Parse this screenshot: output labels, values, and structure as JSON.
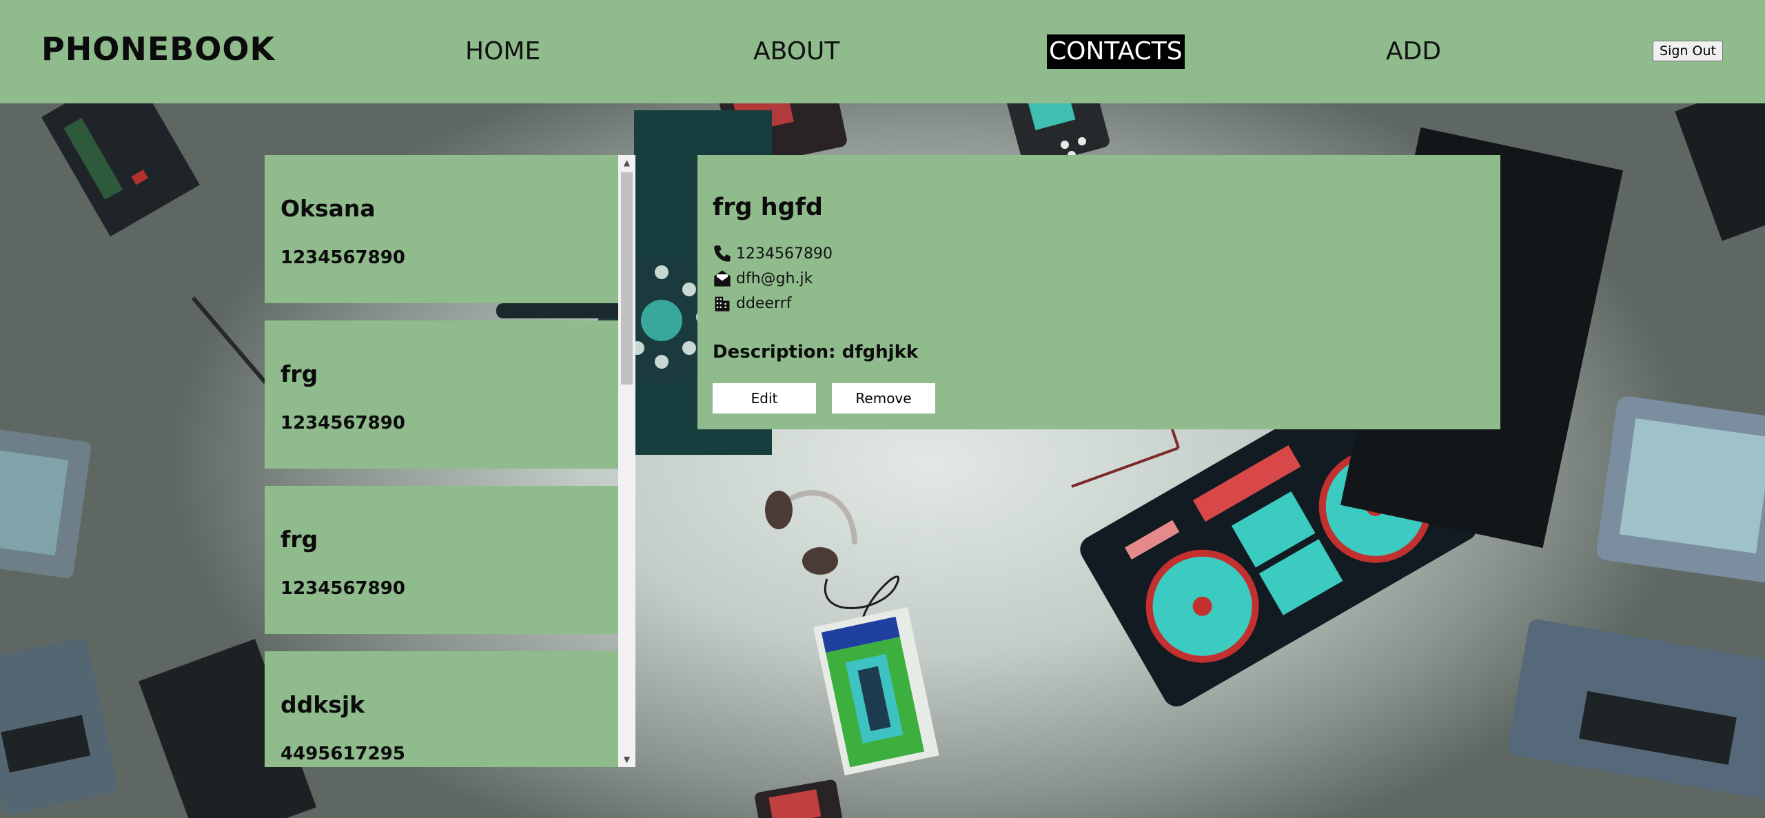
{
  "header": {
    "logo": "PHONEBOOK",
    "nav": [
      {
        "label": "HOME",
        "active": false
      },
      {
        "label": "ABOUT",
        "active": false
      },
      {
        "label": "CONTACTS",
        "active": true
      },
      {
        "label": "ADD",
        "active": false
      }
    ],
    "sign_out_label": "Sign Out"
  },
  "contacts": [
    {
      "name": "Oksana",
      "phone": "1234567890"
    },
    {
      "name": "frg",
      "phone": "1234567890"
    },
    {
      "name": "frg",
      "phone": "1234567890"
    },
    {
      "name": "ddksjk",
      "phone": "4495617295"
    }
  ],
  "selected_contact": {
    "name": "frg hgfd",
    "phone": "1234567890",
    "email": "dfh@gh.jk",
    "address": "ddeerrf",
    "description_label": "Description:",
    "description": "dfghjkk",
    "edit_label": "Edit",
    "remove_label": "Remove",
    "icons": {
      "phone": "phone-icon",
      "email": "envelope-open-icon",
      "address": "building-icon"
    }
  },
  "colors": {
    "accent": "#8fbb8d",
    "active_nav_bg": "#000000",
    "text": "#0b0b0b"
  }
}
